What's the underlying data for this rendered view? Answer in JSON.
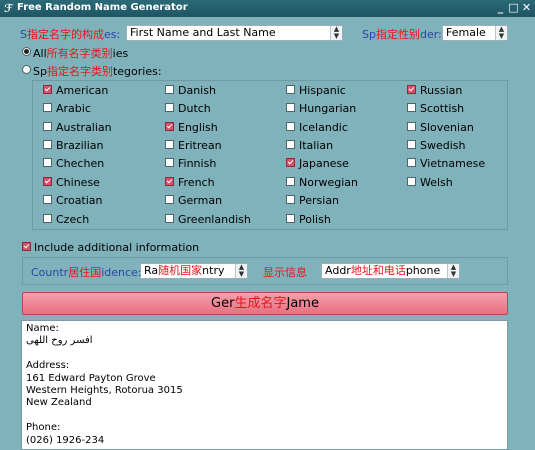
{
  "window": {
    "title": "Free Random Name Generator",
    "controls": [
      "_",
      "□",
      "✕"
    ]
  },
  "name_type": {
    "label_pre": "S",
    "label_annot": "指定名字的构成",
    "label_post": "es:",
    "value": "First Name and Last Name"
  },
  "gender": {
    "label_pre": "Sp",
    "label_annot": "指定性别",
    "label_post": "der:",
    "value": "Female"
  },
  "category_mode": {
    "all": {
      "pre": "All",
      "annot": "所有名字类别",
      "post": "ies",
      "selected": true
    },
    "specific": {
      "pre": "Sp",
      "annot": "指定名字类别",
      "post": "tegories:",
      "selected": false
    }
  },
  "categories": {
    "col1": [
      {
        "label": "American",
        "checked": true
      },
      {
        "label": "Arabic",
        "checked": false
      },
      {
        "label": "Australian",
        "checked": false
      },
      {
        "label": "Brazilian",
        "checked": false
      },
      {
        "label": "Chechen",
        "checked": false
      },
      {
        "label": "Chinese",
        "checked": true
      },
      {
        "label": "Croatian",
        "checked": false
      },
      {
        "label": "Czech",
        "checked": false
      }
    ],
    "col2": [
      {
        "label": "Danish",
        "checked": false
      },
      {
        "label": "Dutch",
        "checked": false
      },
      {
        "label": "English",
        "checked": true
      },
      {
        "label": "Eritrean",
        "checked": false
      },
      {
        "label": "Finnish",
        "checked": false
      },
      {
        "label": "French",
        "checked": true
      },
      {
        "label": "German",
        "checked": false
      },
      {
        "label": "Greenlandish",
        "checked": false
      }
    ],
    "col3": [
      {
        "label": "Hispanic",
        "checked": false
      },
      {
        "label": "Hungarian",
        "checked": false
      },
      {
        "label": "Icelandic",
        "checked": false
      },
      {
        "label": "Italian",
        "checked": false
      },
      {
        "label": "Japanese",
        "checked": true
      },
      {
        "label": "Norwegian",
        "checked": false
      },
      {
        "label": "Persian",
        "checked": false
      },
      {
        "label": "Polish",
        "checked": false
      }
    ],
    "col4": [
      {
        "label": "Russian",
        "checked": true
      },
      {
        "label": "Scottish",
        "checked": false
      },
      {
        "label": "Slovenian",
        "checked": false
      },
      {
        "label": "Swedish",
        "checked": false
      },
      {
        "label": "Vietnamese",
        "checked": false
      },
      {
        "label": "Welsh",
        "checked": false
      }
    ]
  },
  "additional": {
    "label": "Include additional information",
    "checked": true
  },
  "country": {
    "label_pre": "Countr",
    "label_annot": "居住国",
    "label_post": "idence:",
    "value_pre": "Ra",
    "value_annot": "随机国家",
    "value_post": "ntry"
  },
  "show_info": {
    "label_annot": "显示信息",
    "value_pre": "Addr",
    "value_annot": "地址和电话",
    "value_post": "phone"
  },
  "generate": {
    "pre": "Ger",
    "annot": "生成名字",
    "post": "Jame"
  },
  "output": {
    "lines": [
      "Name:",
      "افسر روح اللهی",
      "",
      "Address:",
      "161 Edward Payton Grove",
      "Western Heights, Rotorua 3015",
      "New Zealand",
      "",
      "Phone:",
      "(026) 1926-234"
    ]
  },
  "colors": {
    "background": "#7fb2ba",
    "titlebar": "#245f6d",
    "annotation": "#e8141c",
    "button": "#ee8696",
    "checked": "#d4546c"
  }
}
